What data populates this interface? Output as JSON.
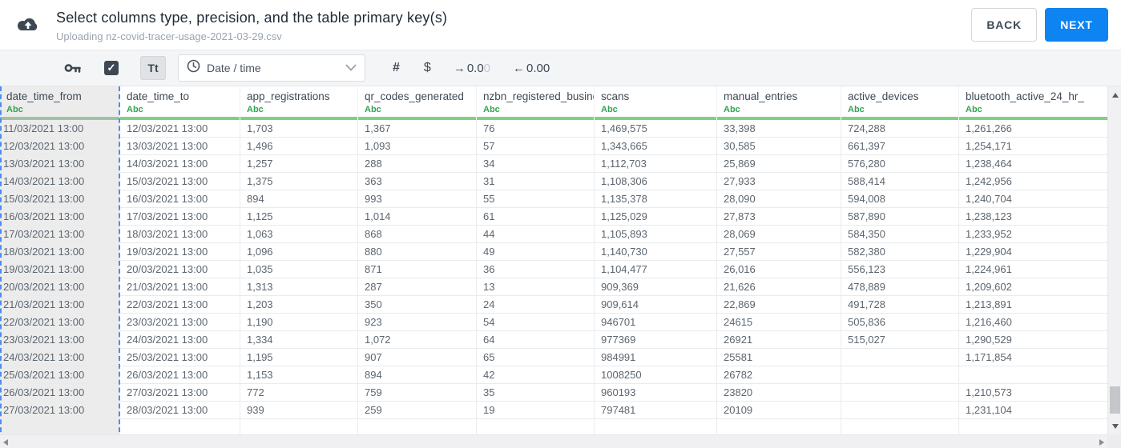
{
  "header": {
    "title": "Select columns type, precision, and the table primary key(s)",
    "subtitle": "Uploading nz-covid-tracer-usage-2021-03-29.csv",
    "back_label": "BACK",
    "next_label": "NEXT"
  },
  "toolbar": {
    "key_icon": "primary-key",
    "checkbox_checked": true,
    "text_type_label": "Tt",
    "type_dropdown_value": "Date / time",
    "number_icon_label": "#",
    "currency_icon_label": "$",
    "decimal_add": {
      "arrow": "→",
      "value_dark": "0.0",
      "value_light": "0"
    },
    "decimal_remove": {
      "arrow": "←",
      "value": "0.00"
    }
  },
  "table": {
    "columns": [
      {
        "name": "date_time_from",
        "type": "Abc",
        "selected": true
      },
      {
        "name": "date_time_to",
        "type": "Abc",
        "selected": false
      },
      {
        "name": "app_registrations",
        "type": "Abc",
        "selected": false
      },
      {
        "name": "qr_codes_generated",
        "type": "Abc",
        "selected": false
      },
      {
        "name": "nzbn_registered_busine",
        "type": "Abc",
        "selected": false
      },
      {
        "name": "scans",
        "type": "Abc",
        "selected": false
      },
      {
        "name": "manual_entries",
        "type": "Abc",
        "selected": false
      },
      {
        "name": "active_devices",
        "type": "Abc",
        "selected": false
      },
      {
        "name": "bluetooth_active_24_hr_",
        "type": "Abc",
        "selected": false
      }
    ],
    "rows": [
      [
        "11/03/2021 13:00",
        "12/03/2021 13:00",
        "1,703",
        "1,367",
        "76",
        "1,469,575",
        "33,398",
        "724,288",
        "1,261,266"
      ],
      [
        "12/03/2021 13:00",
        "13/03/2021 13:00",
        "1,496",
        "1,093",
        "57",
        "1,343,665",
        "30,585",
        "661,397",
        "1,254,171"
      ],
      [
        "13/03/2021 13:00",
        "14/03/2021 13:00",
        "1,257",
        "288",
        "34",
        "1,112,703",
        "25,869",
        "576,280",
        "1,238,464"
      ],
      [
        "14/03/2021 13:00",
        "15/03/2021 13:00",
        "1,375",
        "363",
        "31",
        "1,108,306",
        "27,933",
        "588,414",
        "1,242,956"
      ],
      [
        "15/03/2021 13:00",
        "16/03/2021 13:00",
        "894",
        "993",
        "55",
        "1,135,378",
        "28,090",
        "594,008",
        "1,240,704"
      ],
      [
        "16/03/2021 13:00",
        "17/03/2021 13:00",
        "1,125",
        "1,014",
        "61",
        "1,125,029",
        "27,873",
        "587,890",
        "1,238,123"
      ],
      [
        "17/03/2021 13:00",
        "18/03/2021 13:00",
        "1,063",
        "868",
        "44",
        "1,105,893",
        "28,069",
        "584,350",
        "1,233,952"
      ],
      [
        "18/03/2021 13:00",
        "19/03/2021 13:00",
        "1,096",
        "880",
        "49",
        "1,140,730",
        "27,557",
        "582,380",
        "1,229,904"
      ],
      [
        "19/03/2021 13:00",
        "20/03/2021 13:00",
        "1,035",
        "871",
        "36",
        "1,104,477",
        "26,016",
        "556,123",
        "1,224,961"
      ],
      [
        "20/03/2021 13:00",
        "21/03/2021 13:00",
        "1,313",
        "287",
        "13",
        "909,369",
        "21,626",
        "478,889",
        "1,209,602"
      ],
      [
        "21/03/2021 13:00",
        "22/03/2021 13:00",
        "1,203",
        "350",
        "24",
        "909,614",
        "22,869",
        "491,728",
        "1,213,891"
      ],
      [
        "22/03/2021 13:00",
        "23/03/2021 13:00",
        "1,190",
        "923",
        "54",
        "946701",
        "24615",
        "505,836",
        "1,216,460"
      ],
      [
        "23/03/2021 13:00",
        "24/03/2021 13:00",
        "1,334",
        "1,072",
        "64",
        "977369",
        "26921",
        "515,027",
        "1,290,529"
      ],
      [
        "24/03/2021 13:00",
        "25/03/2021 13:00",
        "1,195",
        "907",
        "65",
        "984991",
        "25581",
        "",
        "1,171,854"
      ],
      [
        "25/03/2021 13:00",
        "26/03/2021 13:00",
        "1,153",
        "894",
        "42",
        "1008250",
        "26782",
        "",
        ""
      ],
      [
        "26/03/2021 13:00",
        "27/03/2021 13:00",
        "772",
        "759",
        "35",
        "960193",
        "23820",
        "",
        "1,210,573"
      ],
      [
        "27/03/2021 13:00",
        "28/03/2021 13:00",
        "939",
        "259",
        "19",
        "797481",
        "20109",
        "",
        "1,231,104"
      ]
    ]
  },
  "colors": {
    "accent_blue": "#0e83f2",
    "type_green": "#33a352",
    "bar_green": "#7ed184",
    "selection_dashed_blue": "#4a8df8",
    "dark_icon": "#3d4852"
  }
}
